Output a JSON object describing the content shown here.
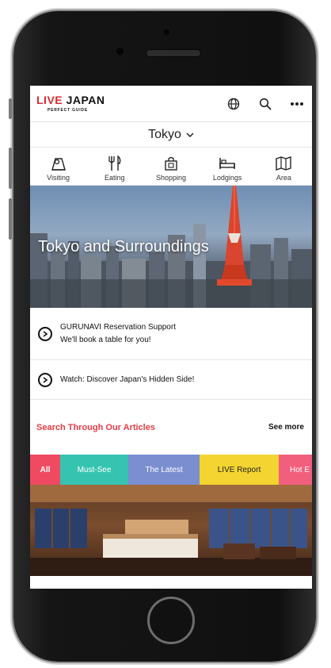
{
  "app": {
    "logo_live": "LIVE",
    "logo_japan": "JAPAN",
    "logo_sub": "PERFECT GUIDE"
  },
  "header_icons": [
    "globe-icon",
    "search-icon",
    "more-icon"
  ],
  "city": {
    "name": "Tokyo"
  },
  "categories": [
    {
      "label": "Visiting",
      "icon": "sightseeing-icon"
    },
    {
      "label": "Eating",
      "icon": "utensils-icon"
    },
    {
      "label": "Shopping",
      "icon": "shopping-bag-icon"
    },
    {
      "label": "Lodgings",
      "icon": "bed-icon"
    },
    {
      "label": "Area",
      "icon": "map-icon"
    }
  ],
  "hero": {
    "title": "Tokyo and Surroundings"
  },
  "links": [
    {
      "line1": "GURUNAVI Reservation Support",
      "line2": "We'll book a table for you!"
    },
    {
      "line1": "Watch: Discover Japan's Hidden Side!"
    }
  ],
  "articles": {
    "title": "Search Through Our Articles",
    "see_more": "See more",
    "tabs": [
      "All",
      "Must-See",
      "The Latest",
      "LIVE Report",
      "Hot E"
    ]
  },
  "colors": {
    "brand_red": "#d92b32",
    "tab_all": "#ef4a62",
    "tab_must_see": "#36c4b0",
    "tab_latest": "#7a8ed0",
    "tab_live": "#f3d431",
    "tab_hot": "#f25f7d"
  }
}
